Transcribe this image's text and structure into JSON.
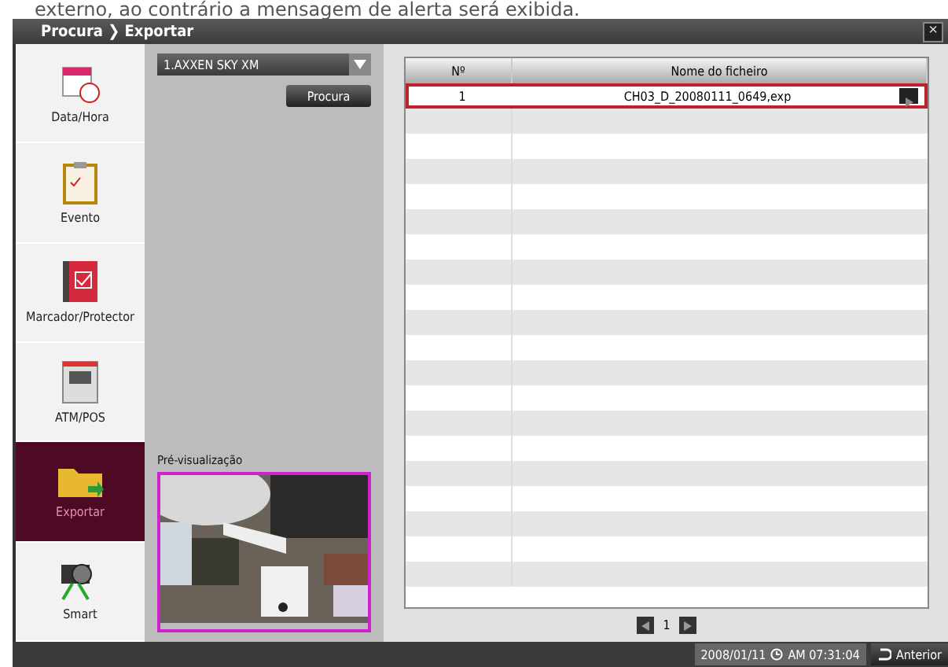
{
  "caption": "externo, ao contrário a mensagem de alerta será exibida.",
  "window": {
    "title": "Procura ❯ Exportar",
    "close": "×"
  },
  "sidebar": {
    "items": [
      {
        "label": "Data/Hora",
        "selected": false
      },
      {
        "label": "Evento",
        "selected": false
      },
      {
        "label": "Marcador/Protector",
        "selected": false
      },
      {
        "label": "ATM/POS",
        "selected": false
      },
      {
        "label": "Exportar",
        "selected": true
      },
      {
        "label": "Smart",
        "selected": false
      }
    ]
  },
  "search": {
    "device": "1.AXXEN SKY XM",
    "button": "Procura",
    "preview_label": "Pré-visualização"
  },
  "table": {
    "columns": [
      "Nº",
      "Nome do ficheiro"
    ],
    "rows": [
      {
        "number": "1",
        "file": "CH03_D_20080111_0649,exp",
        "selected": true
      }
    ]
  },
  "pagination": {
    "page": "1"
  },
  "status_bar": {
    "date": "2008/01/11",
    "time": "AM 07:31:04",
    "back": "Anterior"
  }
}
